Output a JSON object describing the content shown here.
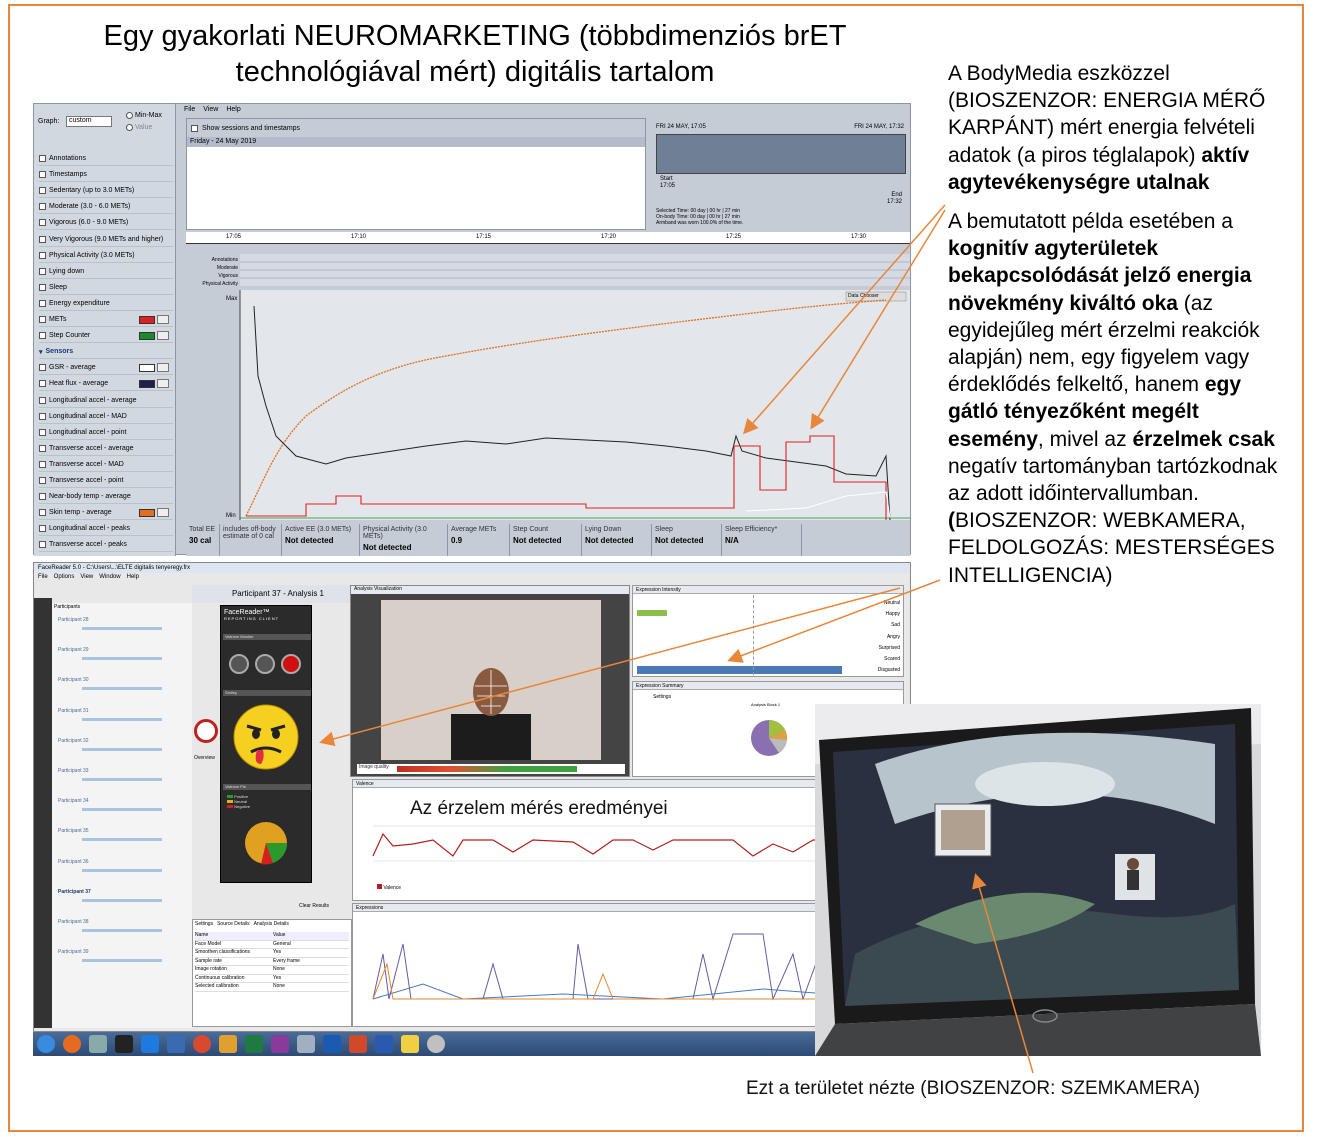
{
  "title_lines": [
    "Egy gyakorlati NEUROMARKETING (többdimenziós brET",
    "technológiával mért) digitális tartalom"
  ],
  "side_text": {
    "p1_normal": "A BodyMedia eszközzel (BIOSZENZOR: ENERGIA MÉRŐ KARPÁNT) mért energia felvételi adatok (a piros téglalapok) ",
    "p1_bold": "aktív agytevékenységre utalnak",
    "p2_a": "A bemutatott példa esetében a ",
    "p2_b": "kognitív agyterületek bekapcsolódását jelző energia növekmény kiváltó oka",
    "p2_c": " (az egyidejűleg mért érzelmi reakciók alapján) nem, egy figyelem vagy érdeklődés felkeltő, hanem ",
    "p2_d": "egy gátló tényezőként megélt esemény",
    "p2_e": ", mivel az ",
    "p2_f": "érzelmek csak",
    "p2_g": " negatív tartományban tartózkodnak az adott időintervallumban.",
    "p2_h": "(",
    "p2_i": "BIOSZENZOR: WEBKAMERA, FELDOLGOZÁS: MESTERSÉGES INTELLIGENCIA)"
  },
  "bodymedia": {
    "menu": [
      "File",
      "View",
      "Help"
    ],
    "graph_label": "Graph:",
    "graph_value": "custom",
    "minmax": "Min-Max",
    "value": "Value",
    "show_sessions": "Show sessions and timestamps",
    "session_date": "Friday - 24 May 2019",
    "range_start": "FRI 24 MAY, 17:05",
    "range_end": "FRI 24 MAY, 17:32",
    "start_label": "Start",
    "start_time": "17:05",
    "end_label": "End",
    "end_time": "17:32",
    "selected_time": "Selected Time:   00 day | 00 hr | 27 min",
    "onbody_time": "On-body Time:   00 day | 00 hr | 27 min",
    "armband": "Armband was worn 100.0% of the time.",
    "ticks": [
      "17:05",
      "17:10",
      "17:15",
      "17:20",
      "17:25",
      "17:30"
    ],
    "rows": [
      "Annotations",
      "Moderate",
      "Vigorous",
      "Physical Activity"
    ],
    "data_chooser": "Data Chooser",
    "max": "Max",
    "min": "Min",
    "left_items": [
      "Annotations",
      "Timestamps",
      "Sedentary (up to 3.0 METs)",
      "Moderate (3.0 - 6.0 METs)",
      "Vigorous (6.0 - 9.0 METs)",
      "Very Vigorous (9.0 METs and higher)",
      "Physical Activity (3.0 METs)",
      "Lying down",
      "Sleep",
      "Energy expenditure",
      "METs",
      "Step Counter",
      "Sensors",
      "GSR - average",
      "Heat flux - average",
      "Longitudinal accel - average",
      "Longitudinal accel - MAD",
      "Longitudinal accel - point",
      "Transverse accel - average",
      "Transverse accel - MAD",
      "Transverse accel - point",
      "Near-body temp - average",
      "Skin temp - average",
      "Longitudinal accel - peaks",
      "Transverse accel - peaks"
    ],
    "stats": [
      {
        "label": "Total EE",
        "value": "30 cal"
      },
      {
        "label": "includes off-body estimate of 0 cal",
        "value": ""
      },
      {
        "label": "Active EE (3.0 METs)",
        "value": "Not detected"
      },
      {
        "label": "Physical Activity (3.0 METs)",
        "value": "Not detected"
      },
      {
        "label": "Average METs",
        "value": "0.9"
      },
      {
        "label": "Step Count",
        "value": "Not detected"
      },
      {
        "label": "Lying Down",
        "value": "Not detected"
      },
      {
        "label": "Sleep",
        "value": "Not detected"
      },
      {
        "label": "Sleep Efficiency*",
        "value": "N/A"
      }
    ],
    "colors": {
      "mets": "#e02020",
      "steps": "#1a8a2a",
      "gsr": "#ffffff",
      "heatflux": "#202050",
      "skin": "#e07020"
    }
  },
  "facereader": {
    "window_title": "FaceReader 5.0 - C:\\Users\\...\\ELTE digitalis tenyeregy.frx",
    "menu": [
      "File",
      "Options",
      "View",
      "Window",
      "Help"
    ],
    "participants_header": "Participants",
    "participant_title": "Participant 37 - Analysis 1",
    "client_title": "FaceReader",
    "client_sub": "REPORTING CLIENT",
    "valence_monitor": "Valence Monitor",
    "smiley_label": "Smiley",
    "valence_pie": "Valence Pie",
    "legend": [
      "Positive",
      "Neutral",
      "Negative"
    ],
    "analysis_vis": "Analysis Visualization",
    "image_quality": "Image quality",
    "expression_intensity": "Expression Intensity",
    "emotions": [
      "Neutral",
      "Happy",
      "Sad",
      "Angry",
      "Surprised",
      "Scared",
      "Disgusted"
    ],
    "expression_summary": "Expression Summary",
    "settings_btn": "Settings",
    "analysis_block": "Analysis Block 1",
    "valence": "Valence",
    "expressions": "Expressions",
    "clear_results": "Clear Results",
    "overview": "Overview",
    "settings_tabs": [
      "Settings",
      "Source Details",
      "Analysis Details"
    ],
    "settings_rows": [
      [
        "Name",
        "Value"
      ],
      [
        "Face Model",
        "General"
      ],
      [
        "Smoothen classifications",
        "Yes"
      ],
      [
        "Sample rate",
        "Every frame"
      ],
      [
        "Image rotation",
        "None"
      ],
      [
        "Continuous calibration",
        "Yes"
      ],
      [
        "Selected calibration",
        "None"
      ]
    ],
    "participants": [
      "Participant 28",
      "Participant 29",
      "Participant 30",
      "Participant 31",
      "Participant 32",
      "Participant 33",
      "Participant 34",
      "Participant 35",
      "Participant 36",
      "Participant 37",
      "Participant 38",
      "Participant 39"
    ],
    "emotion_result_label": "Az érzelem mérés eredményei"
  },
  "caption": "Ezt a területet nézte (BIOSZENZOR: SZEMKAMERA)"
}
